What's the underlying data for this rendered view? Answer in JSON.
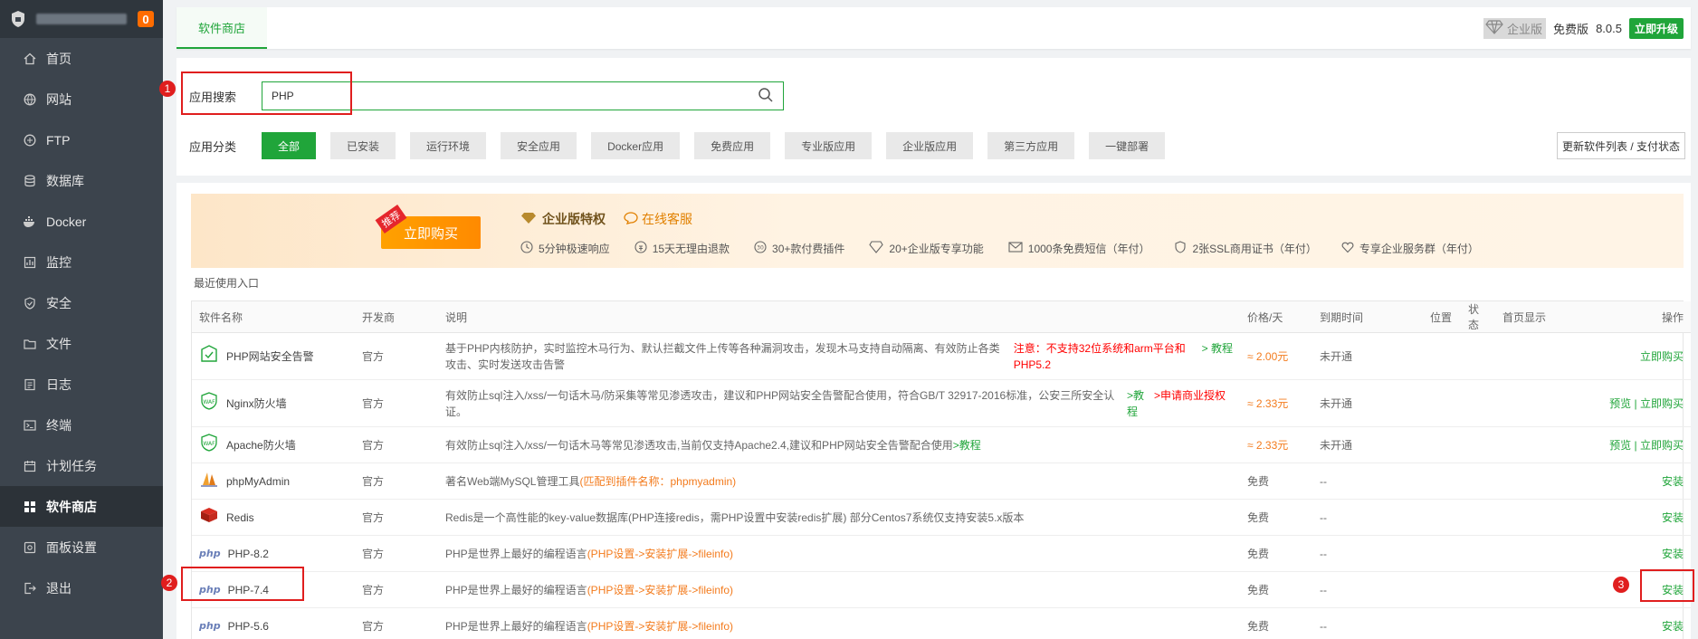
{
  "sidebar": {
    "badge": "0",
    "items": [
      {
        "label": "首页",
        "icon": "home-icon"
      },
      {
        "label": "网站",
        "icon": "globe-icon"
      },
      {
        "label": "FTP",
        "icon": "ftp-icon"
      },
      {
        "label": "数据库",
        "icon": "database-icon"
      },
      {
        "label": "Docker",
        "icon": "docker-icon"
      },
      {
        "label": "监控",
        "icon": "monitor-icon"
      },
      {
        "label": "安全",
        "icon": "shield-icon"
      },
      {
        "label": "文件",
        "icon": "folder-icon"
      },
      {
        "label": "日志",
        "icon": "log-icon"
      },
      {
        "label": "终端",
        "icon": "terminal-icon"
      },
      {
        "label": "计划任务",
        "icon": "calendar-icon"
      },
      {
        "label": "软件商店",
        "icon": "grid-icon",
        "active": true
      },
      {
        "label": "面板设置",
        "icon": "settings-icon"
      },
      {
        "label": "退出",
        "icon": "logout-icon"
      }
    ]
  },
  "header": {
    "tab": "软件商店",
    "enterprise": "企业版",
    "free": "免费版",
    "version": "8.0.5",
    "upgrade": "立即升级"
  },
  "search": {
    "label": "应用搜索",
    "value": "PHP"
  },
  "categories": {
    "label": "应用分类",
    "items": [
      "全部",
      "已安装",
      "运行环境",
      "安全应用",
      "Docker应用",
      "免费应用",
      "专业版应用",
      "企业版应用",
      "第三方应用",
      "一键部署"
    ],
    "refresh": "更新软件列表 / 支付状态"
  },
  "banner": {
    "tag": "推荐",
    "buy": "立即购买",
    "title": "企业版特权",
    "service": "在线客服",
    "features": [
      "5分钟极速响应",
      "15天无理由退款",
      "30+款付费插件",
      "20+企业版专享功能",
      "1000条免费短信（年付）",
      "2张SSL商用证书（年付）",
      "专享企业服务群（年付）"
    ]
  },
  "recent": "最近使用入口",
  "table": {
    "headers": [
      "软件名称",
      "开发商",
      "说明",
      "价格/天",
      "到期时间",
      "位置",
      "状态",
      "首页显示",
      "操作"
    ],
    "rows": [
      {
        "name": "PHP网站安全告警",
        "dev": "官方",
        "desc": "基于PHP内核防护，实时监控木马行为、默认拦截文件上传等各种漏洞攻击，发现木马支持自动隔离、有效防止各类攻击、实时发送攻击告警",
        "note_red": "注意：不支持32位系统和arm平台和PHP5.2",
        "note_green": "> 教程",
        "price": "≈ 2.00元",
        "expire": "未开通",
        "preview": "",
        "op": "立即购买"
      },
      {
        "name": "Nginx防火墙",
        "dev": "官方",
        "desc": "有效防止sql注入/xss/一句话木马/防采集等常见渗透攻击，建议和PHP网站安全告警配合使用，符合GB/T 32917-2016标准，公安三所安全认证。",
        "note_green": ">教程",
        "note_red": ">申请商业授权",
        "price": "≈ 2.33元",
        "expire": "未开通",
        "preview": "预览",
        "op": "立即购买"
      },
      {
        "name": "Apache防火墙",
        "dev": "官方",
        "desc": "有效防止sql注入/xss/一句话木马等常见渗透攻击,当前仅支持Apache2.4,建议和PHP网站安全告警配合使用",
        "note_green": ">教程",
        "price": "≈ 2.33元",
        "expire": "未开通",
        "preview": "预览",
        "op": "立即购买"
      },
      {
        "name": "phpMyAdmin",
        "dev": "官方",
        "desc": "著名Web端MySQL管理工具",
        "note_orange": "(匹配到插件名称：phpmyadmin)",
        "price": "免费",
        "expire": "--",
        "op": "安装"
      },
      {
        "name": "Redis",
        "dev": "官方",
        "desc": "Redis是一个高性能的key-value数据库(PHP连接redis，需PHP设置中安装redis扩展) 部分Centos7系统仅支持安装5.x版本",
        "price": "免费",
        "expire": "--",
        "op": "安装"
      },
      {
        "name": "PHP-8.2",
        "dev": "官方",
        "desc": "PHP是世界上最好的编程语言",
        "note_orange": "(PHP设置->安装扩展->fileinfo)",
        "price": "免费",
        "expire": "--",
        "op": "安装"
      },
      {
        "name": "PHP-7.4",
        "dev": "官方",
        "desc": "PHP是世界上最好的编程语言",
        "note_orange": "(PHP设置->安装扩展->fileinfo)",
        "price": "免费",
        "expire": "--",
        "op": "安装"
      },
      {
        "name": "PHP-5.6",
        "dev": "官方",
        "desc": "PHP是世界上最好的编程语言",
        "note_orange": "(PHP设置->安装扩展->fileinfo)",
        "price": "免费",
        "expire": "--",
        "op": "安装"
      }
    ]
  },
  "annotations": [
    "1",
    "2",
    "3"
  ],
  "colors": {
    "accent": "#20a53a",
    "sidebar": "#3c444d",
    "annotation": "#e01e1e",
    "price": "#f37b1d"
  }
}
